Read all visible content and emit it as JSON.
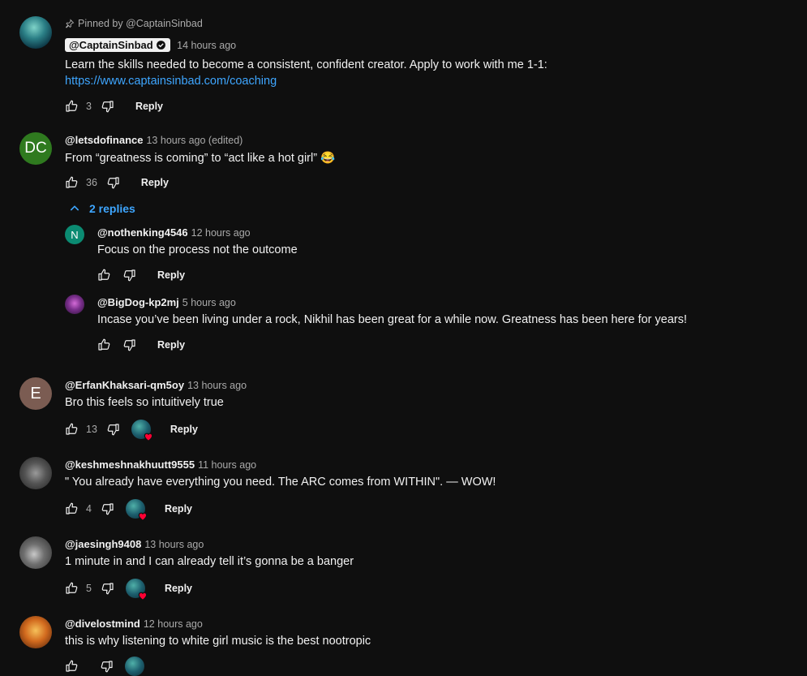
{
  "pinned": {
    "label": "Pinned by @CaptainSinbad",
    "author": "@CaptainSinbad",
    "time": "14 hours ago",
    "text": "Learn the skills needed to become a consistent, confident creator. Apply to work with me 1-1:",
    "link": "https://www.captainsinbad.com/coaching",
    "likes": "3",
    "reply_label": "Reply"
  },
  "comments": [
    {
      "avatar_letter": "DC",
      "avatar_color": "#2f7a1f",
      "author": "@letsdofinance",
      "time": "13 hours ago (edited)",
      "text": "From “greatness is coming” to “act like a hot girl” 😂",
      "likes": "36",
      "reply_label": "Reply",
      "replies_toggle": "2 replies",
      "replies": [
        {
          "avatar_letter": "N",
          "avatar_color": "#0b8b72",
          "author": "@nothenking4546",
          "time": "12 hours ago",
          "text": "Focus on the process not the outcome",
          "reply_label": "Reply"
        },
        {
          "author": "@BigDog-kp2mj",
          "time": "5 hours ago",
          "text": "Incase you’ve been living under a rock, Nikhil has been great for a while now. Greatness has been here for years!",
          "reply_label": "Reply"
        }
      ]
    },
    {
      "avatar_letter": "E",
      "avatar_color": "#7b5c52",
      "author": "@ErfanKhaksari-qm5oy",
      "time": "13 hours ago",
      "text": "Bro this feels so intuitively true",
      "likes": "13",
      "reply_label": "Reply"
    },
    {
      "author": "@keshmeshnakhuutt9555",
      "time": "11 hours ago",
      "text": "\" You already have everything you need. The ARC comes from WITHIN\". — WOW!",
      "likes": "4",
      "reply_label": "Reply"
    },
    {
      "author": "@jaesingh9408",
      "time": "13 hours ago",
      "text": "1 minute in and I can already tell it’s gonna be a banger",
      "likes": "5",
      "reply_label": "Reply"
    },
    {
      "author": "@divelostmind",
      "time": "12 hours ago",
      "text": "this is why listening to white girl music is the best nootropic"
    }
  ],
  "colors": {
    "background": "#0f0f0f",
    "link": "#3ea6ff",
    "heart": "#ff0033"
  }
}
